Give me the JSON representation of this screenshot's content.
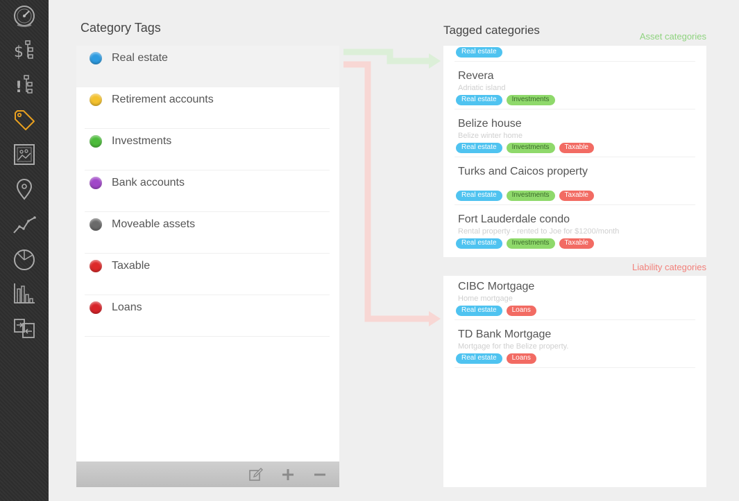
{
  "sidebar": {
    "items": [
      {
        "icon": "dashboard-gauge-icon"
      },
      {
        "icon": "accounts-tree-icon"
      },
      {
        "icon": "alerts-tree-icon"
      },
      {
        "icon": "tag-icon",
        "active": true
      },
      {
        "icon": "portrait-picture-icon"
      },
      {
        "icon": "location-pin-icon"
      },
      {
        "icon": "line-chart-icon"
      },
      {
        "icon": "pie-chart-icon"
      },
      {
        "icon": "bar-chart-icon"
      },
      {
        "icon": "transfer-icon"
      }
    ]
  },
  "tags_panel": {
    "title": "Category Tags",
    "tags": [
      {
        "label": "Real estate",
        "color": "#2e9be0",
        "selected": true
      },
      {
        "label": "Retirement accounts",
        "color": "#f3c12e"
      },
      {
        "label": "Investments",
        "color": "#4cbb3a"
      },
      {
        "label": "Bank accounts",
        "color": "#a046c8"
      },
      {
        "label": "Moveable assets",
        "color": "#6a6a6a"
      },
      {
        "label": "Taxable",
        "color": "#dd2a2a"
      },
      {
        "label": "Loans",
        "color": "#d8242a"
      }
    ],
    "toolbar": {
      "edit_icon": "edit-icon",
      "add_icon": "plus-icon",
      "remove_icon": "minus-icon"
    }
  },
  "tagged_panel": {
    "title": "Tagged categories",
    "asset_label": "Asset categories",
    "liability_label": "Liability categories",
    "asset_items": [
      {
        "name": "",
        "desc": "",
        "badges": [
          "Real estate"
        ]
      },
      {
        "name": "Revera",
        "desc": "Adriatic island",
        "badges": [
          "Real estate",
          "Investments"
        ]
      },
      {
        "name": "Belize house",
        "desc": "Belize winter home",
        "badges": [
          "Real estate",
          "Investments",
          "Taxable"
        ]
      },
      {
        "name": "Turks and Caicos property",
        "desc": "",
        "badges": [
          "Real estate",
          "Investments",
          "Taxable"
        ]
      },
      {
        "name": "Fort Lauderdale condo",
        "desc": "Rental property - rented to Joe for $1200/month",
        "badges": [
          "Real estate",
          "Investments",
          "Taxable"
        ]
      }
    ],
    "liability_items": [
      {
        "name": "CIBC Mortgage",
        "desc": "Home mortgage",
        "badges": [
          "Real estate",
          "Loans"
        ]
      },
      {
        "name": "TD Bank Mortgage",
        "desc": "Mortgage for the Belize property.",
        "badges": [
          "Real estate",
          "Loans"
        ]
      }
    ]
  },
  "colors": {
    "asset_label": "#8fd37f",
    "liability_label": "#f2807a",
    "asset_arrow": "#dcefd8",
    "liability_arrow": "#f8d7d4",
    "badge_real_estate": "#4fc3f0",
    "badge_investments": "#8fd96b",
    "badge_taxable": "#f26b63",
    "badge_loans": "#f26b63",
    "active_icon": "#e8a020"
  }
}
